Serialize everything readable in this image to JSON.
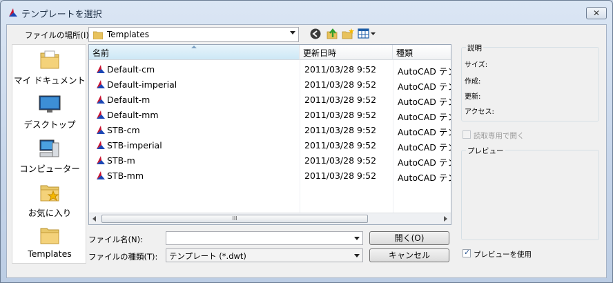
{
  "window": {
    "title": "テンプレートを選択",
    "close_glyph": "✕"
  },
  "lookin": {
    "label": "ファイルの場所(I):",
    "value": "Templates"
  },
  "places": [
    {
      "label": "マイ ドキュメント",
      "icon": "my-documents-icon"
    },
    {
      "label": "デスクトップ",
      "icon": "desktop-icon"
    },
    {
      "label": "コンピューター",
      "icon": "computer-icon"
    },
    {
      "label": "お気に入り",
      "icon": "favorites-icon"
    },
    {
      "label": "Templates",
      "icon": "templates-folder-icon"
    }
  ],
  "columns": {
    "name": "名前",
    "date": "更新日時",
    "type": "種類"
  },
  "files": [
    {
      "name": "Default-cm",
      "date": "2011/03/28 9:52",
      "type": "AutoCAD テン"
    },
    {
      "name": "Default-imperial",
      "date": "2011/03/28 9:52",
      "type": "AutoCAD テン"
    },
    {
      "name": "Default-m",
      "date": "2011/03/28 9:52",
      "type": "AutoCAD テン"
    },
    {
      "name": "Default-mm",
      "date": "2011/03/28 9:52",
      "type": "AutoCAD テン"
    },
    {
      "name": "STB-cm",
      "date": "2011/03/28 9:52",
      "type": "AutoCAD テン"
    },
    {
      "name": "STB-imperial",
      "date": "2011/03/28 9:52",
      "type": "AutoCAD テン"
    },
    {
      "name": "STB-m",
      "date": "2011/03/28 9:52",
      "type": "AutoCAD テン"
    },
    {
      "name": "STB-mm",
      "date": "2011/03/28 9:52",
      "type": "AutoCAD テン"
    }
  ],
  "scroll_thumb_glyph": "III",
  "filename": {
    "label": "ファイル名(N):",
    "value": ""
  },
  "filetype": {
    "label": "ファイルの種類(T):",
    "value": "テンプレート (*.dwt)"
  },
  "buttons": {
    "open": "開く(O)",
    "cancel": "キャンセル"
  },
  "description": {
    "title": "説明",
    "size_label": "サイズ:",
    "created_label": "作成:",
    "modified_label": "更新:",
    "access_label": "アクセス:"
  },
  "readonly": {
    "label": "読取専用で開く",
    "checked": false
  },
  "preview": {
    "title": "プレビュー",
    "use_label": "プレビューを使用",
    "checked": true,
    "check_glyph": "✓"
  },
  "colors": {
    "autocad_red": "#c8102e",
    "autocad_blue": "#1a46b5",
    "folder_yellow": "#f4d27a"
  }
}
